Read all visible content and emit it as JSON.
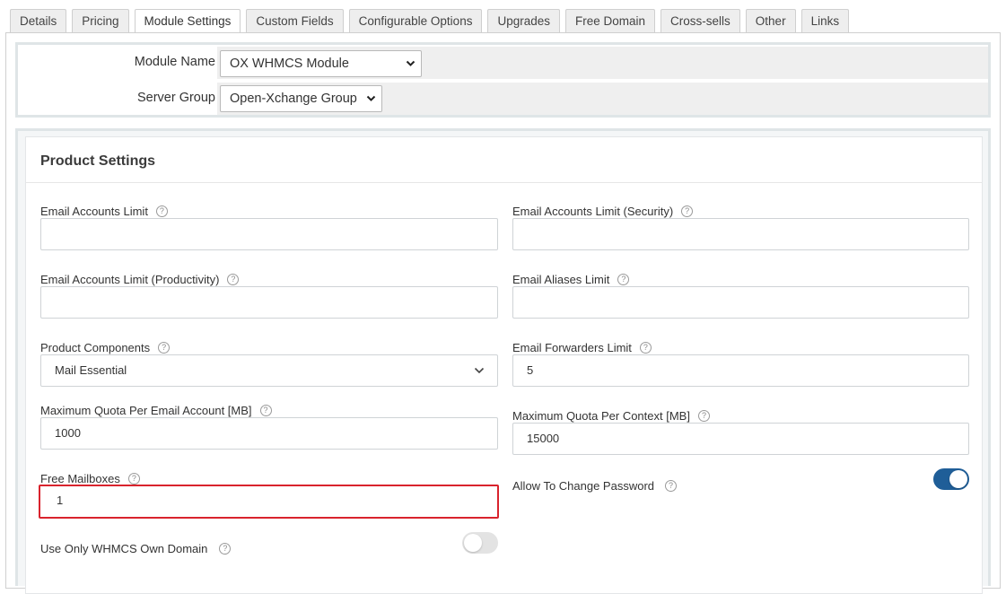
{
  "tabs": [
    {
      "label": "Details",
      "active": false
    },
    {
      "label": "Pricing",
      "active": false
    },
    {
      "label": "Module Settings",
      "active": true
    },
    {
      "label": "Custom Fields",
      "active": false
    },
    {
      "label": "Configurable Options",
      "active": false
    },
    {
      "label": "Upgrades",
      "active": false
    },
    {
      "label": "Free Domain",
      "active": false
    },
    {
      "label": "Cross-sells",
      "active": false
    },
    {
      "label": "Other",
      "active": false
    },
    {
      "label": "Links",
      "active": false
    }
  ],
  "module": {
    "module_name_label": "Module Name",
    "module_name_value": "OX WHMCS Module",
    "server_group_label": "Server Group",
    "server_group_value": "Open-Xchange Group"
  },
  "product_settings": {
    "title": "Product Settings",
    "help_glyph": "?",
    "chevron_glyph": "⌄",
    "fields": {
      "email_accounts_limit": {
        "label": "Email Accounts Limit",
        "value": ""
      },
      "email_accounts_limit_security": {
        "label": "Email Accounts Limit (Security)",
        "value": ""
      },
      "email_accounts_limit_productivity": {
        "label": "Email Accounts Limit (Productivity)",
        "value": ""
      },
      "email_aliases_limit": {
        "label": "Email Aliases Limit",
        "value": ""
      },
      "product_components": {
        "label": "Product Components",
        "value": "Mail Essential"
      },
      "email_forwarders_limit": {
        "label": "Email Forwarders Limit",
        "value": "5"
      },
      "max_quota_per_account": {
        "label": "Maximum Quota Per Email Account [MB]",
        "value": "1000"
      },
      "max_quota_per_context": {
        "label": "Maximum Quota Per Context [MB]",
        "value": "15000"
      },
      "free_mailboxes": {
        "label": "Free Mailboxes",
        "value": "1"
      },
      "allow_change_password": {
        "label": "Allow To Change Password",
        "enabled": true
      },
      "use_only_whmcs_domain": {
        "label": "Use Only WHMCS Own Domain",
        "enabled": false
      }
    }
  },
  "colors": {
    "accent": "#1f5e98",
    "highlight_border": "#d9232d"
  }
}
